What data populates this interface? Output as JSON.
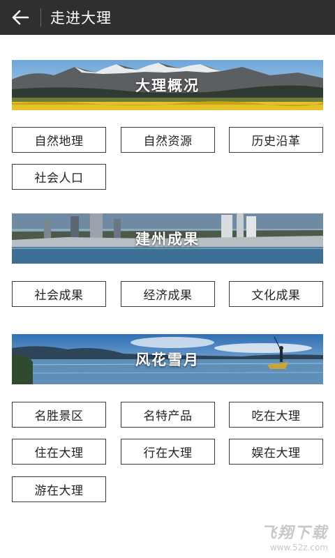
{
  "header": {
    "title": "走进大理",
    "back_icon": "back-arrow-icon"
  },
  "sections": [
    {
      "banner": "大理概况",
      "items": [
        "自然地理",
        "自然资源",
        "历史沿革",
        "社会人口"
      ]
    },
    {
      "banner": "建州成果",
      "items": [
        "社会成果",
        "经济成果",
        "文化成果"
      ]
    },
    {
      "banner": "风花雪月",
      "items": [
        "名胜景区",
        "名特产品",
        "吃在大理",
        "住在大理",
        "行在大理",
        "娱在大理",
        "游在大理"
      ]
    }
  ],
  "watermark": {
    "main": "飞翔下载",
    "sub": "www.52z.com"
  },
  "colors": {
    "topbar": "#2e2f31",
    "border": "#3a3a3a",
    "background": "#ffffff"
  }
}
